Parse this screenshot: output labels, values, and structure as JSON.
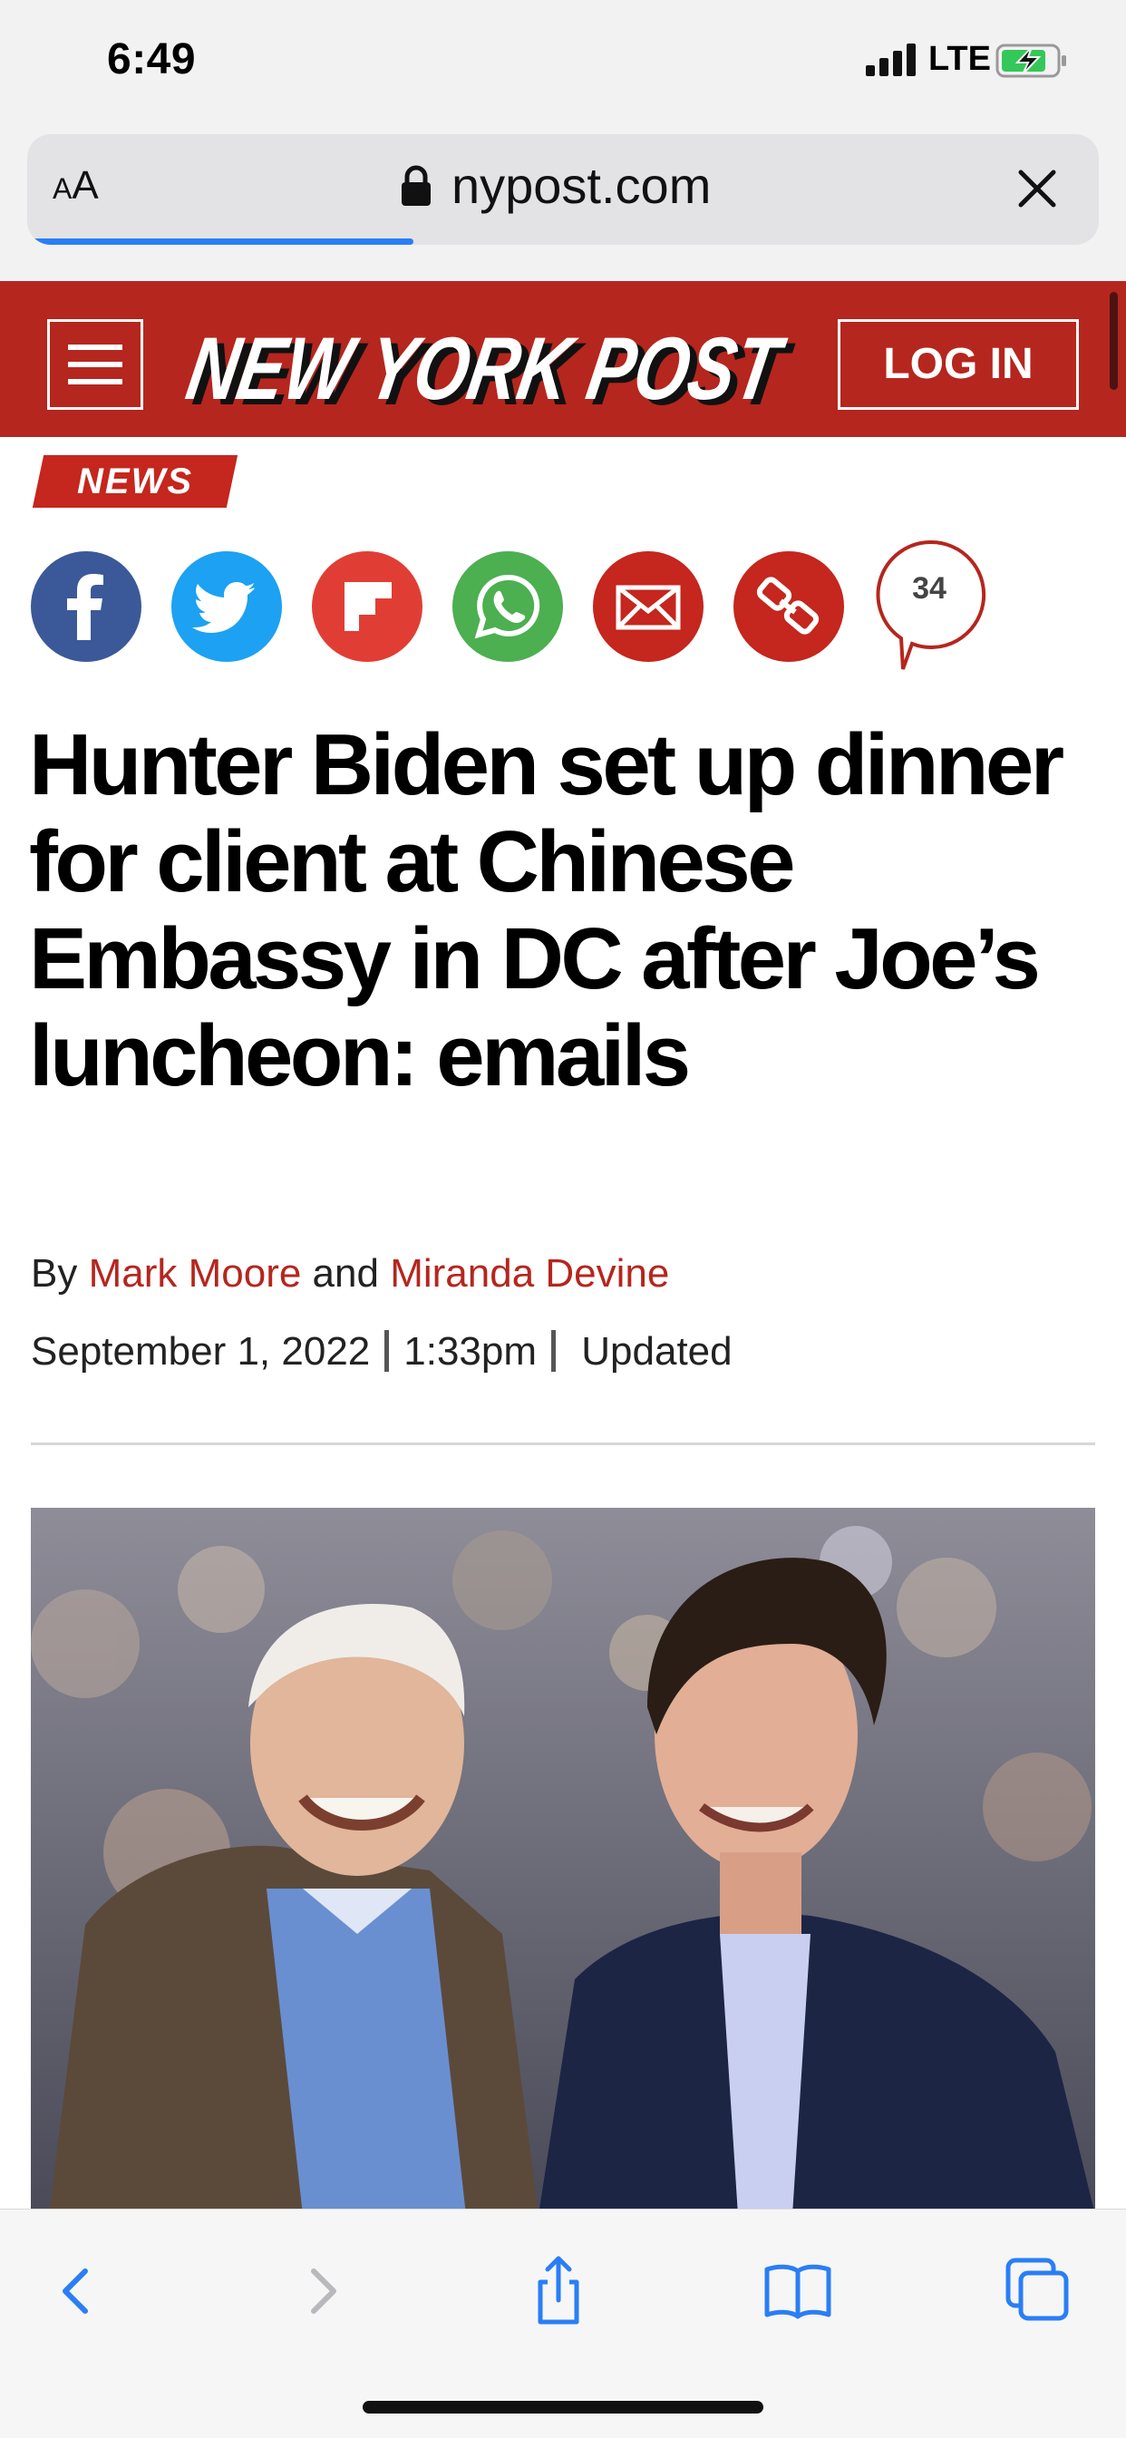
{
  "status_bar": {
    "time": "6:49",
    "network": "LTE",
    "battery_icon": "battery-charging-icon"
  },
  "browser": {
    "text_size_label": "AA",
    "domain": "nypost.com",
    "load_progress": 0.36,
    "close_icon": "close-icon"
  },
  "masthead": {
    "logo_text": "NEW YORK POST",
    "login_label": "LOG IN",
    "brand_color": "#b5261e"
  },
  "article": {
    "section": "NEWS",
    "share_icons": [
      "facebook-icon",
      "twitter-icon",
      "flipboard-icon",
      "whatsapp-icon",
      "email-icon",
      "copy-link-icon"
    ],
    "comment_count": "34",
    "headline": "Hunter Biden set up dinner for client at Chinese Embassy in DC after Joe’s luncheon: emails",
    "byline": {
      "by": "By",
      "author1": "Mark Moore",
      "and": "and",
      "author2": "Miranda Devine"
    },
    "date": "September 1, 2022",
    "time": "1:33pm",
    "updated_label": "Updated"
  },
  "toolbar": {
    "items": [
      "back-icon",
      "forward-icon",
      "share-icon",
      "bookmarks-icon",
      "tabs-icon"
    ]
  }
}
